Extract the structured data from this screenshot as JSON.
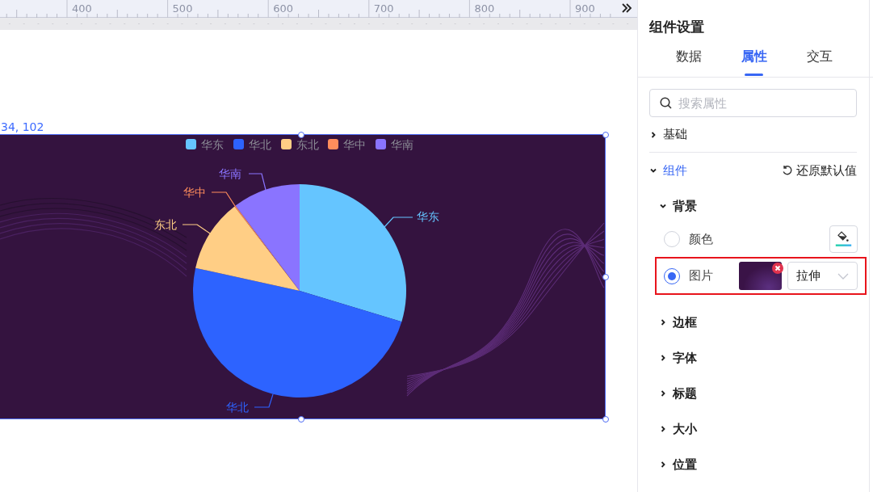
{
  "ruler": {
    "labels": [
      "400",
      "500",
      "600",
      "700",
      "800",
      "900"
    ]
  },
  "canvas": {
    "coordinates": "34, 102",
    "chart": {
      "legend": [
        {
          "label": "华东",
          "color": "#65c5ff"
        },
        {
          "label": "华北",
          "color": "#2d63ff"
        },
        {
          "label": "东北",
          "color": "#ffce85"
        },
        {
          "label": "华中",
          "color": "#ff8d5c"
        },
        {
          "label": "华南",
          "color": "#8a74ff"
        }
      ],
      "slice_labels": [
        {
          "label": "华东",
          "color": "#65c5ff"
        },
        {
          "label": "华北",
          "color": "#2d63ff"
        },
        {
          "label": "东北",
          "color": "#ffce85"
        },
        {
          "label": "华中",
          "color": "#ff8d5c"
        },
        {
          "label": "华南",
          "color": "#8a74ff"
        }
      ]
    }
  },
  "panel": {
    "title": "组件设置",
    "tabs": [
      {
        "label": "数据",
        "selected": false
      },
      {
        "label": "属性",
        "selected": true
      },
      {
        "label": "交互",
        "selected": false
      }
    ],
    "search": {
      "placeholder": "搜索属性"
    },
    "sections": [
      {
        "label": "基础",
        "expanded": false
      },
      {
        "label": "组件",
        "expanded": true,
        "action": "还原默认值",
        "children": [
          {
            "label": "背景",
            "expanded": true,
            "options": [
              {
                "kind": "color",
                "label": "颜色",
                "selected": false,
                "highlighted": false
              },
              {
                "kind": "image",
                "label": "图片",
                "selected": true,
                "highlighted": true,
                "fit": "拉伸"
              }
            ]
          },
          {
            "label": "边框",
            "expanded": false
          },
          {
            "label": "字体",
            "expanded": false
          },
          {
            "label": "标题",
            "expanded": false
          },
          {
            "label": "大小",
            "expanded": false
          },
          {
            "label": "位置",
            "expanded": false
          }
        ]
      }
    ]
  }
}
